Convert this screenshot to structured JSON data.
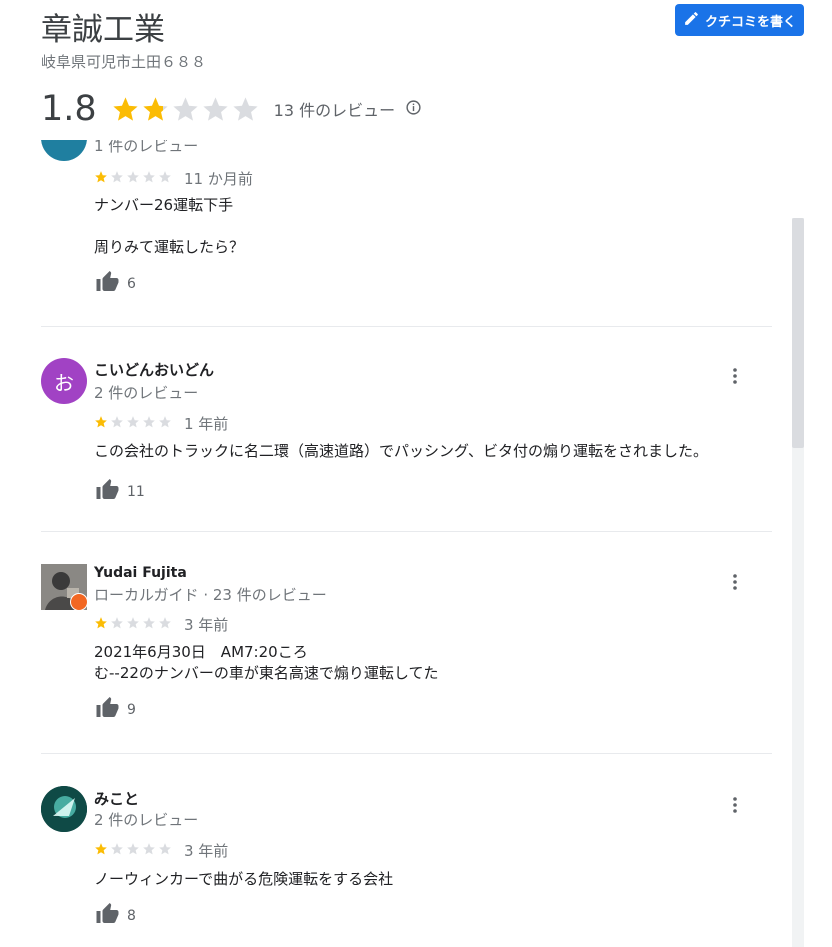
{
  "business": {
    "name": "章誠工業",
    "address": "岐阜県可児市土田６８８",
    "write_review_label": "クチコミを書く",
    "rating": "1.8",
    "rating_value": 1.8,
    "review_count_label": "13 件のレビュー"
  },
  "colors": {
    "star_filled": "#fbbc04",
    "star_empty": "#dadce0",
    "button_blue": "#1a73e8"
  },
  "reviews": [
    {
      "author": "",
      "meta": "1 件のレビュー",
      "rating": 1,
      "date": "11 か月前",
      "text": "ナンバー26運転下手\n\n周りみて運転したら？",
      "likes": "6",
      "avatar_letter": "",
      "avatar_color": "#1f7fa0"
    },
    {
      "author": "こいどんおいどん",
      "meta": "2 件のレビュー",
      "rating": 1,
      "date": "1 年前",
      "text": "この会社のトラックに名二環（高速道路）でパッシング、ビタ付の煽り運転をされました。",
      "likes": "11",
      "avatar_letter": "お",
      "avatar_color": "#a142c4"
    },
    {
      "author": "Yudai Fujita",
      "meta": "ローカルガイド · 23 件のレビュー",
      "rating": 1,
      "date": "3 年前",
      "text": "2021年6月30日　AM7:20ころ\nむ--22のナンバーの車が東名高速で煽り運転してた",
      "likes": "9",
      "avatar_letter": "",
      "avatar_color": "#6b6a68"
    },
    {
      "author": "みこと",
      "meta": "2 件のレビュー",
      "rating": 1,
      "date": "3 年前",
      "text": "ノーウィンカーで曲がる危険運転をする会社",
      "likes": "8",
      "avatar_letter": "",
      "avatar_color": "#0d3b3a"
    }
  ]
}
